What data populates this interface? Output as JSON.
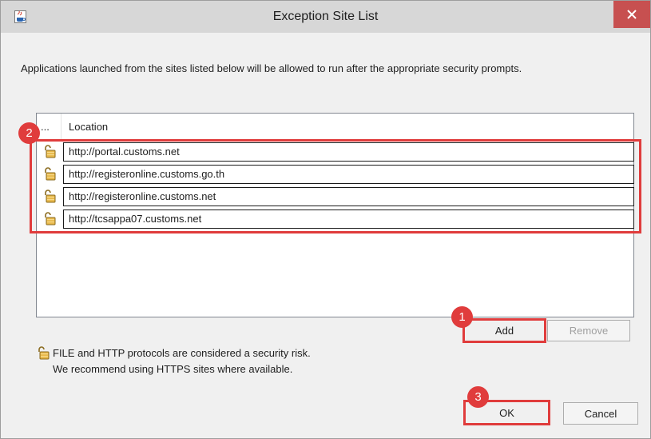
{
  "window": {
    "title": "Exception Site List",
    "app_icon": "java-icon",
    "close_icon": "close-icon"
  },
  "description": "Applications launched from the sites listed below will be allowed to run after the appropriate security prompts.",
  "table": {
    "header_icon_col": "...",
    "header_location": "Location",
    "rows": [
      {
        "icon": "unlocked-padlock-icon",
        "url": "http://portal.customs.net"
      },
      {
        "icon": "unlocked-padlock-icon",
        "url": "http://registeronline.customs.go.th"
      },
      {
        "icon": "unlocked-padlock-icon",
        "url": "http://registeronline.customs.net"
      },
      {
        "icon": "unlocked-padlock-icon",
        "url": "http://tcsappa07.customs.net"
      }
    ]
  },
  "buttons": {
    "add": "Add",
    "remove": "Remove",
    "ok": "OK",
    "cancel": "Cancel"
  },
  "warning": {
    "icon": "unlocked-padlock-icon",
    "line1": "FILE and HTTP protocols are considered a security risk.",
    "line2": "We recommend using HTTPS sites where available."
  },
  "annotations": {
    "step1": "1",
    "step2": "2",
    "step3": "3",
    "highlight_color": "#e03c3c"
  }
}
